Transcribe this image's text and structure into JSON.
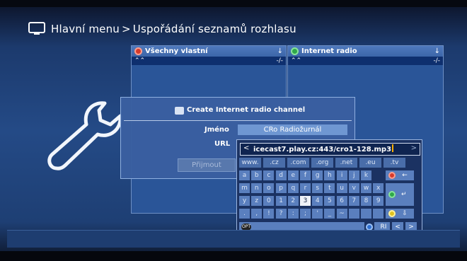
{
  "breadcrumb": {
    "root": "Hlavní menu",
    "separator": ">",
    "current": "Uspořádání seznamů rozhlasu"
  },
  "colors": {
    "red_button": "#d83a2a",
    "green_button": "#2fa84a",
    "yellow_button": "#e0c21e",
    "blue_button": "#2f6fd0",
    "accent_caret": "#ffb000"
  },
  "left_list": {
    "name": "Všechny vlastní",
    "dot_color": "red",
    "download_icon": "↓",
    "sort_up": "⌃⌃",
    "sort_state": "-/-"
  },
  "right_list": {
    "name": "Internet radio",
    "dot_color": "green",
    "download_icon": "↓",
    "sort_up": "⌃⌃",
    "sort_state": "-/-"
  },
  "dialog": {
    "title": "Create Internet radio channel",
    "icon": "globe-icon",
    "name_label": "Jméno",
    "name_value": "CRo Radiožurnál",
    "url_label": "URL",
    "accept_label": "Přijmout"
  },
  "keyboard": {
    "url_value": "icecast7.play.cz:443/cro1-128.mp3",
    "nav_left": "<",
    "nav_right": ">",
    "presets": [
      "www.",
      ".cz",
      ".com",
      ".org",
      ".net",
      ".eu",
      ".tv"
    ],
    "rows": [
      [
        "a",
        "b",
        "c",
        "d",
        "e",
        "f",
        "g",
        "h",
        "i",
        "j",
        "k",
        "l"
      ],
      [
        "m",
        "n",
        "o",
        "p",
        "q",
        "r",
        "s",
        "t",
        "u",
        "v",
        "w",
        "x"
      ],
      [
        "y",
        "z",
        "0",
        "1",
        "2",
        "3",
        "4",
        "5",
        "6",
        "7",
        "8",
        "9"
      ],
      [
        ".",
        ",",
        "!",
        "?",
        ":",
        ";",
        "'",
        "_",
        "~",
        "",
        "",
        ""
      ]
    ],
    "selected_key": "3",
    "backspace_symbol": "←",
    "enter_symbol": "↵",
    "shift_symbol": "⇩",
    "option_label": "OPT",
    "mode_label": "RI",
    "prev_symbol": "<",
    "next_symbol": ">"
  }
}
